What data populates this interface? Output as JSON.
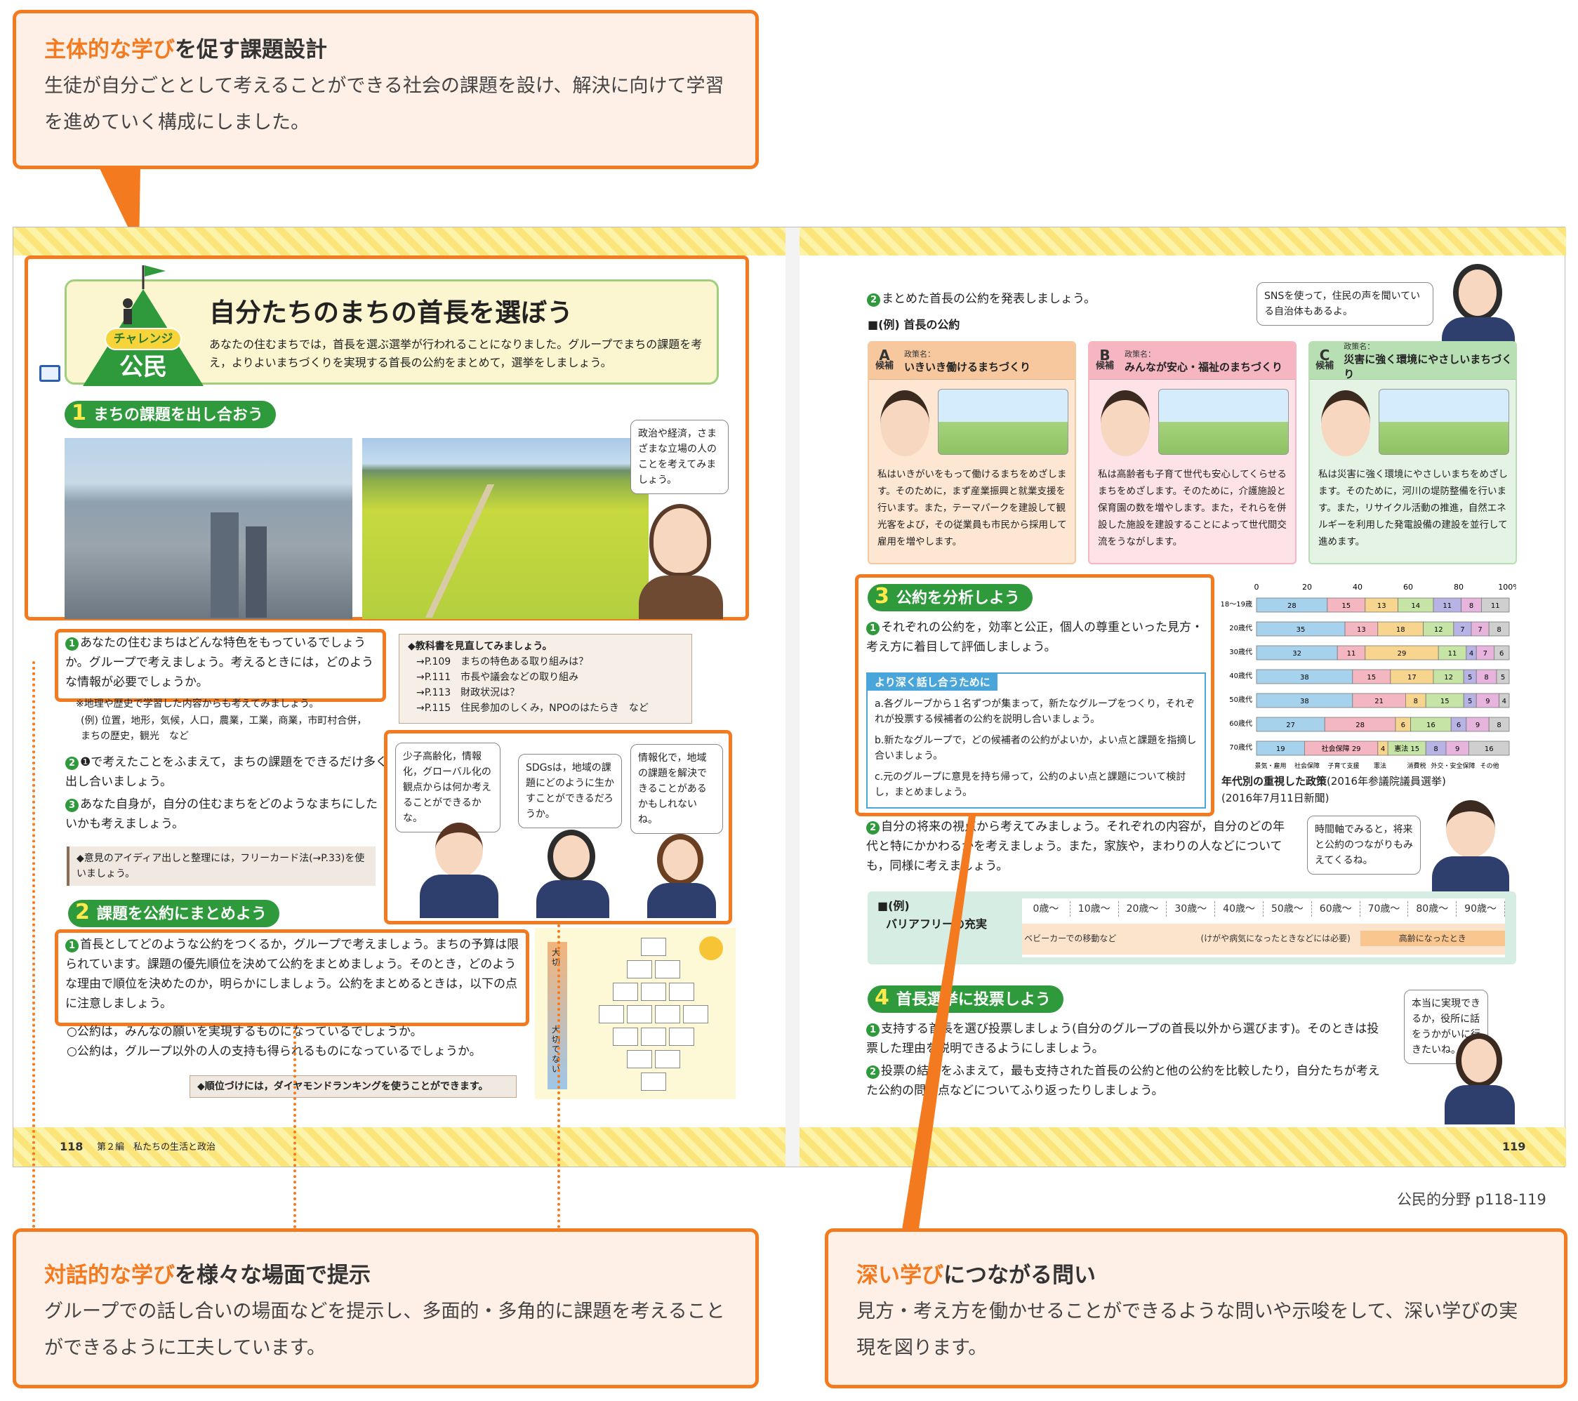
{
  "callouts": {
    "top": {
      "title_hl": "主体的な学び",
      "title_rest": "を促す課題設計",
      "body": "生徒が自分ごととして考えることができる社会の課題を設け、解決に向けて学習を進めていく構成にしました。"
    },
    "bottom_left": {
      "title_hl": "対話的な学び",
      "title_rest": "を様々な場面で提示",
      "body": "グループでの話し合いの場面などを提示し、多面的・多角的に課題を考えることができるように工夫しています。"
    },
    "bottom_right": {
      "title_hl": "深い学び",
      "title_rest": "につながる問い",
      "body": "見方・考え方を働かせることができるような問いや示唆をして、深い学びの実現を図ります。"
    }
  },
  "caption": "公民的分野 p118-119",
  "left_page": {
    "badge_top": "チャレンジ",
    "badge_main": "公民",
    "title": "自分たちのまちの首長を選ぼう",
    "intro": "あなたの住むまちでは，首長を選ぶ選挙が行われることになりました。グループでまちの課題を考え，よりよいまちづくりを実現する首長の公約をまとめて，選挙をしましょう。",
    "sec1": {
      "num": "1",
      "title": "まちの課題を出し合おう"
    },
    "bubble_teacher": "政治や経済，さまざまな立場の人のことを考えてみましょう。",
    "q1": "あなたの住むまちはどんな特色をもっているでしょうか。グループで考えましょう。考えるときには，どのような情報が必要でしょうか。",
    "q1_note": "※地理や歴史で学習した内容からも考えてみましょう。",
    "q1_example": "(例) 位置，地形，気候，人口，農業，工業，商業，市町村合併，まちの歴史，観光　など",
    "q2": "❶で考えたことをふまえて，まちの課題をできるだけ多く出し合いましょう。",
    "q3": "あなた自身が，自分の住むまちをどのようなまちにしたいかも考えましょう。",
    "note_card": "◆意見のアイディア出しと整理には，フリーカード法(→P.33)を使いましょう。",
    "textbook_box": {
      "title": "◆教科書を見直してみましょう。",
      "items": [
        "→P.109　まちの特色ある取り組みは？",
        "→P.111　市長や議会などの取り組み",
        "→P.113　財政状況は？",
        "→P.115　住民参加のしくみ，NPOのはたらき　など"
      ]
    },
    "students": [
      "少子高齢化，情報化，グローバル化の観点からは何か考えることができるかな。",
      "SDGsは，地域の課題にどのように生かすことができるだろうか。",
      "情報化で，地域の課題を解決できることがあるかもしれないね。"
    ],
    "sec2": {
      "num": "2",
      "title": "課題を公約にまとめよう"
    },
    "p2": "首長としてどのような公約をつくるか，グループで考えましょう。まちの予算は限られています。課題の優先順位を決めて公約をまとめましょう。そのとき，どのような理由で順位を決めたのか，明らかにしましょう。公約をまとめるときは，以下の点に注意しましょう。",
    "p2_items": [
      "○公約は，みんなの願いを実現するものになっているでしょうか。",
      "○公約は，グループ以外の人の支持も得られるものになっているでしょうか。"
    ],
    "diamond_note": "◆順位づけには，ダイヤモンドランキングを使うことができます。",
    "arrow_top": "大切",
    "arrow_bottom": "大切でない",
    "page_num": "118",
    "footer": "第２編　私たちの生活と政治"
  },
  "right_page": {
    "step2": "まとめた首長の公約を発表しましょう。",
    "example_head": "■(例) 首長の公約",
    "bubble_sns": "SNSを使って，住民の声を聞いている自治体もあるよ。",
    "candidates": [
      {
        "letter": "A",
        "sub": "候補",
        "label": "政策名：",
        "policy": "いきいき働けるまちづくり",
        "text": "私はいきがいをもって働けるまちをめざします。そのために，まず産業振興と就業支援を行います。また，テーマパークを建設して観光客をよび，その従業員も市民から採用して雇用を増やします。",
        "color": "#fde7d2",
        "head": "#f7c89e"
      },
      {
        "letter": "B",
        "sub": "候補",
        "label": "政策名：",
        "policy": "みんなが安心・福祉のまちづくり",
        "text": "私は高齢者も子育て世代も安心してくらせるまちをめざします。そのために，介護施設と保育園の数を増やします。また，それらを併設した施設を建設することによって世代間交流をうながします。",
        "color": "#fde3e7",
        "head": "#f5b6c2"
      },
      {
        "letter": "C",
        "sub": "候補",
        "label": "政策名：",
        "policy": "災害に強く環境にやさしいまちづくり",
        "text": "私は災害に強く環境にやさしいまちをめざします。そのために，河川の堤防整備を行います。また，リサイクル活動の推進，自然エネルギーを利用した発電設備の建設を並行して進めます。",
        "color": "#e4f3e3",
        "head": "#b7dfb3"
      }
    ],
    "sec3": {
      "num": "3",
      "title": "公約を分析しよう"
    },
    "q3_1": "それぞれの公約を，効率と公正，個人の尊重といった見方・考え方に着目して評価しましょう。",
    "deep_head": "より深く話し合うために",
    "deep_items": [
      "a.各グループから１名ずつが集まって，新たなグループをつくり，それぞれが投票する候補者の公約を説明し合いましょう。",
      "b.新たなグループで，どの候補者の公約がよいか，よい点と課題を指摘し合いましょう。",
      "c.元のグループに意見を持ち帰って，公約のよい点と課題について検討し，まとめましょう。"
    ],
    "q3_2": "自分の将来の視点から考えてみましょう。それぞれの内容が，自分のどの年代と特にかかわるかを考えましょう。また，家族や，まわりの人などについても，同様に考えましょう。",
    "bubble_time": "時間軸でみると，将来と公約のつながりもみえてくるね。",
    "timeline": {
      "ex": "■(例)",
      "label": "バリアフリーの充実",
      "ages": [
        "0歳〜",
        "10歳〜",
        "20歳〜",
        "30歳〜",
        "40歳〜",
        "50歳〜",
        "60歳〜",
        "70歳〜",
        "80歳〜",
        "90歳〜"
      ],
      "notes": [
        "ベビーカーでの移動など",
        "(けがや病気になったときなどには必要)",
        "高齢になったとき"
      ]
    },
    "sec4": {
      "num": "4",
      "title": "首長選挙に投票しよう"
    },
    "q4_1": "支持する首長を選び投票しましょう(自分のグループの首長以外から選びます)。そのときは投票した理由を説明できるようにしましょう。",
    "q4_2": "投票の結果をふまえて，最も支持された首長の公約と他の公約を比較したり，自分たちが考えた公約の問題点などについてふり返ったりしましょう。",
    "bubble_end": "本当に実現できるか，役所に話をうかがいに行きたいね。",
    "chart_caption": "年代別の重視した政策",
    "chart_caption2": "(2016年参議院議員選挙)",
    "chart_source": "(2016年7月11日新聞)",
    "page_num": "119"
  },
  "chart_data": {
    "type": "bar",
    "stacked": true,
    "orientation": "horizontal",
    "x_ticks": [
      "0",
      "20",
      "40",
      "60",
      "80",
      "100%"
    ],
    "categories": [
      "18～19歳",
      "20歳代",
      "30歳代",
      "40歳代",
      "50歳代",
      "60歳代",
      "70歳代"
    ],
    "series": [
      {
        "name": "景気・雇用",
        "color": "#a7d2ee",
        "values": [
          28,
          35,
          32,
          38,
          38,
          27,
          19
        ]
      },
      {
        "name": "社会保障",
        "color": "#f4b6c0",
        "values": [
          15,
          13,
          11,
          15,
          21,
          28,
          29
        ]
      },
      {
        "name": "子育て支援",
        "color": "#f8d58e",
        "values": [
          13,
          18,
          29,
          17,
          8,
          6,
          4
        ]
      },
      {
        "name": "憲法",
        "color": "#c7e4a7",
        "values": [
          14,
          12,
          11,
          12,
          15,
          16,
          15
        ]
      },
      {
        "name": "消費税",
        "color": "#b7b3e4",
        "values": [
          11,
          7,
          4,
          5,
          5,
          6,
          8
        ]
      },
      {
        "name": "外交・安全保障",
        "color": "#e7b4dd",
        "values": [
          8,
          7,
          7,
          8,
          9,
          9,
          9
        ]
      },
      {
        "name": "その他",
        "color": "#cfcfcf",
        "values": [
          11,
          8,
          6,
          5,
          4,
          8,
          16
        ]
      }
    ],
    "series_labels": [
      [
        "28",
        "15",
        "13",
        "14",
        "11",
        "8",
        "11"
      ],
      [
        "35",
        "13",
        "18",
        "12",
        "7",
        "7",
        "8"
      ],
      [
        "32",
        "11",
        "29",
        "11",
        "4",
        "7",
        "6"
      ],
      [
        "38",
        "15",
        "17",
        "12",
        "5",
        "8",
        "5"
      ],
      [
        "38",
        "21",
        "8",
        "15",
        "5",
        "9",
        "4"
      ],
      [
        "27",
        "28",
        "6",
        "16",
        "6",
        "9",
        "8"
      ],
      [
        "19",
        "社会保障 29",
        "4",
        "憲法 15",
        "8",
        "9",
        "16"
      ]
    ]
  }
}
